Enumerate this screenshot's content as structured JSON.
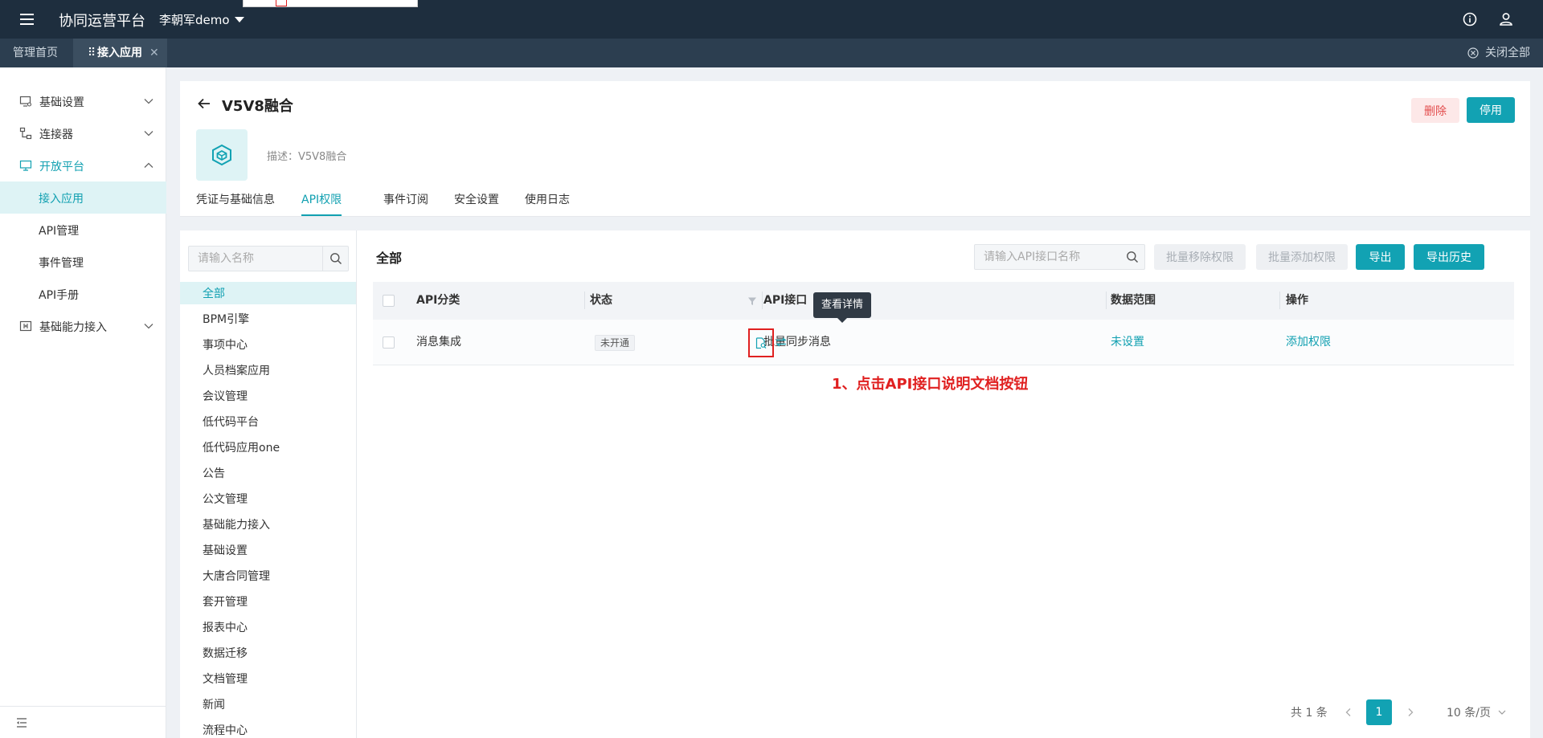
{
  "topbar": {
    "title": "协同运营平台",
    "user": "李朝军demo"
  },
  "tabbar": {
    "home": "管理首页",
    "active": "接入应用",
    "drag_glyph": "⠿",
    "close_glyph": "✕",
    "close_all": "关闭全部"
  },
  "sidebar": {
    "items": [
      {
        "label": "基础设置",
        "icon": "monitor-settings-icon",
        "expanded": false
      },
      {
        "label": "连接器",
        "icon": "connector-icon",
        "expanded": false
      },
      {
        "label": "开放平台",
        "icon": "monitor-icon",
        "expanded": true
      },
      {
        "label": "基础能力接入",
        "icon": "grid-plus-icon",
        "expanded": false
      }
    ],
    "subitems": [
      "接入应用",
      "API管理",
      "事件管理",
      "API手册"
    ]
  },
  "header": {
    "app_name": "V5V8融合",
    "description": "描述：V5V8融合",
    "delete_label": "删除",
    "disable_label": "停用",
    "tabs": [
      "凭证与基础信息",
      "API权限",
      "事件订阅",
      "安全设置",
      "使用日志"
    ],
    "active_tab": "API权限"
  },
  "categories": {
    "search_placeholder": "请输入名称",
    "items": [
      "全部",
      "BPM引擎",
      "事项中心",
      "人员档案应用",
      "会议管理",
      "低代码平台",
      "低代码应用one",
      "公告",
      "公文管理",
      "基础能力接入",
      "基础设置",
      "大唐合同管理",
      "套开管理",
      "报表中心",
      "数据迁移",
      "文档管理",
      "新闻",
      "流程中心"
    ],
    "active": "全部"
  },
  "main": {
    "title": "全部",
    "search_placeholder": "请输入API接口名称",
    "batch_remove": "批量移除权限",
    "batch_add": "批量添加权限",
    "export": "导出",
    "export_history": "导出历史"
  },
  "table": {
    "columns": [
      "API分类",
      "状态",
      "API接口",
      "数据范围",
      "操作"
    ],
    "rows": [
      {
        "category": "消息集成",
        "status": "未开通",
        "api": "批量同步消息",
        "scope": "未设置",
        "action": "添加权限"
      }
    ]
  },
  "tooltip": "查看详情",
  "annotation": "1、点击API接口说明文档按钮",
  "pager": {
    "total": "共 1 条",
    "current": "1",
    "page_size": "10 条/页"
  },
  "colors": {
    "accent": "#12a2b3",
    "topbar": "#1e2e3e",
    "danger": "#e02020"
  }
}
